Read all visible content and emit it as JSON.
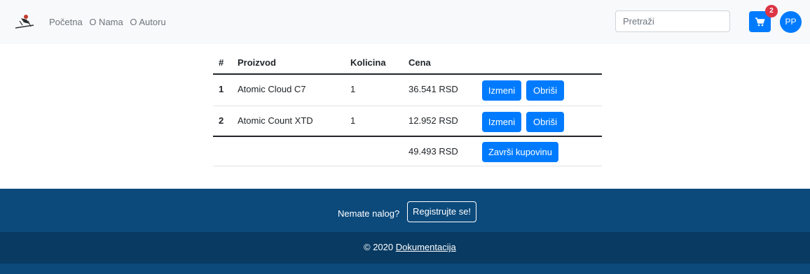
{
  "nav": {
    "links": [
      "Početna",
      "O Nama",
      "O Autoru"
    ],
    "search_placeholder": "Pretraži",
    "cart_count": "2",
    "avatar_initials": "PP"
  },
  "table": {
    "headers": {
      "num": "#",
      "product": "Proizvod",
      "qty": "Kolicina",
      "price": "Cena"
    },
    "rows": [
      {
        "num": "1",
        "product": "Atomic Cloud C7",
        "qty": "1",
        "price": "36.541 RSD",
        "edit": "Izmeni",
        "delete": "Obriši"
      },
      {
        "num": "2",
        "product": "Atomic Count XTD",
        "qty": "1",
        "price": "12.952 RSD",
        "edit": "Izmeni",
        "delete": "Obriši"
      }
    ],
    "total": "49.493 RSD",
    "checkout_label": "Završi kupovinu"
  },
  "footer": {
    "prompt": "Nemate nalog?",
    "register_label": "Registrujte se!",
    "copyright": "© 2020 ",
    "doc_link": "Dokumentacija"
  }
}
